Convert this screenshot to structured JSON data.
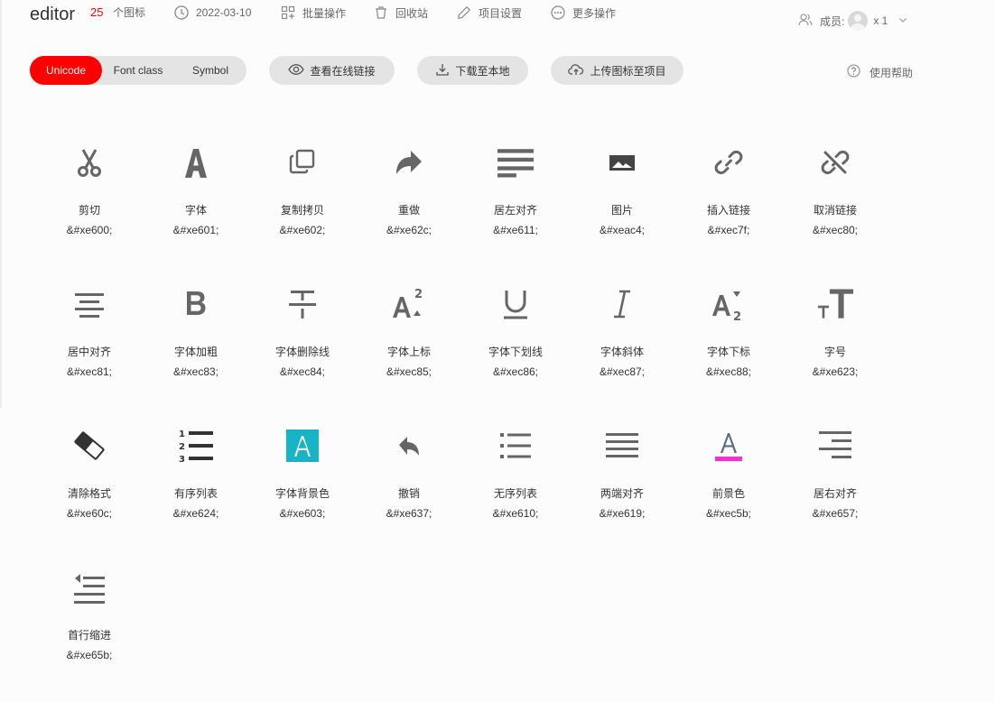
{
  "project": {
    "name": "editor",
    "icon_count": "25",
    "icon_count_label": "个图标",
    "date": "2022-03-10",
    "batch_label": "批量操作",
    "recycle_label": "回收站",
    "settings_label": "项目设置",
    "more_label": "更多操作",
    "members_label": "成员:",
    "members_count": "x 1"
  },
  "toolbar": {
    "tabs": [
      {
        "label": "Unicode",
        "active": true
      },
      {
        "label": "Font class",
        "active": false
      },
      {
        "label": "Symbol",
        "active": false
      }
    ],
    "view_online_label": "查看在线链接",
    "download_label": "下载至本地",
    "upload_label": "上传图标至项目",
    "help_label": "使用帮助"
  },
  "colors": {
    "accent": "#ff0000",
    "icon_gray": "#666666",
    "icon_teal": "#17b3c7",
    "icon_magenta": "#ff2dd5"
  },
  "icons": [
    {
      "name": "剪切",
      "code": "&#xe600;",
      "icon": "scissors-icon"
    },
    {
      "name": "字体",
      "code": "&#xe601;",
      "icon": "font-icon"
    },
    {
      "name": "复制拷贝",
      "code": "&#xe602;",
      "icon": "copy-icon"
    },
    {
      "name": "重做",
      "code": "&#xe62c;",
      "icon": "redo-icon"
    },
    {
      "name": "居左对齐",
      "code": "&#xe611;",
      "icon": "align-left-icon"
    },
    {
      "name": "图片",
      "code": "&#xeac4;",
      "icon": "image-icon"
    },
    {
      "name": "插入链接",
      "code": "&#xec7f;",
      "icon": "link-icon"
    },
    {
      "name": "取消链接",
      "code": "&#xec80;",
      "icon": "unlink-icon"
    },
    {
      "name": "居中对齐",
      "code": "&#xec81;",
      "icon": "align-center-icon"
    },
    {
      "name": "字体加粗",
      "code": "&#xec83;",
      "icon": "bold-icon"
    },
    {
      "name": "字体删除线",
      "code": "&#xec84;",
      "icon": "strikethrough-icon"
    },
    {
      "name": "字体上标",
      "code": "&#xec85;",
      "icon": "superscript-icon"
    },
    {
      "name": "字体下划线",
      "code": "&#xec86;",
      "icon": "underline-icon"
    },
    {
      "name": "字体斜体",
      "code": "&#xec87;",
      "icon": "italic-icon"
    },
    {
      "name": "字体下标",
      "code": "&#xec88;",
      "icon": "subscript-icon"
    },
    {
      "name": "字号",
      "code": "&#xe623;",
      "icon": "font-size-icon"
    },
    {
      "name": "清除格式",
      "code": "&#xe60c;",
      "icon": "eraser-icon"
    },
    {
      "name": "有序列表",
      "code": "&#xe624;",
      "icon": "ordered-list-icon"
    },
    {
      "name": "字体背景色",
      "code": "&#xe603;",
      "icon": "background-color-icon"
    },
    {
      "name": "撤销",
      "code": "&#xe637;",
      "icon": "undo-icon"
    },
    {
      "name": "无序列表",
      "code": "&#xe610;",
      "icon": "unordered-list-icon"
    },
    {
      "name": "两端对齐",
      "code": "&#xe619;",
      "icon": "justify-icon"
    },
    {
      "name": "前景色",
      "code": "&#xec5b;",
      "icon": "font-color-icon"
    },
    {
      "name": "居右对齐",
      "code": "&#xe657;",
      "icon": "align-right-icon"
    },
    {
      "name": "首行缩进",
      "code": "&#xe65b;",
      "icon": "indent-icon"
    }
  ]
}
